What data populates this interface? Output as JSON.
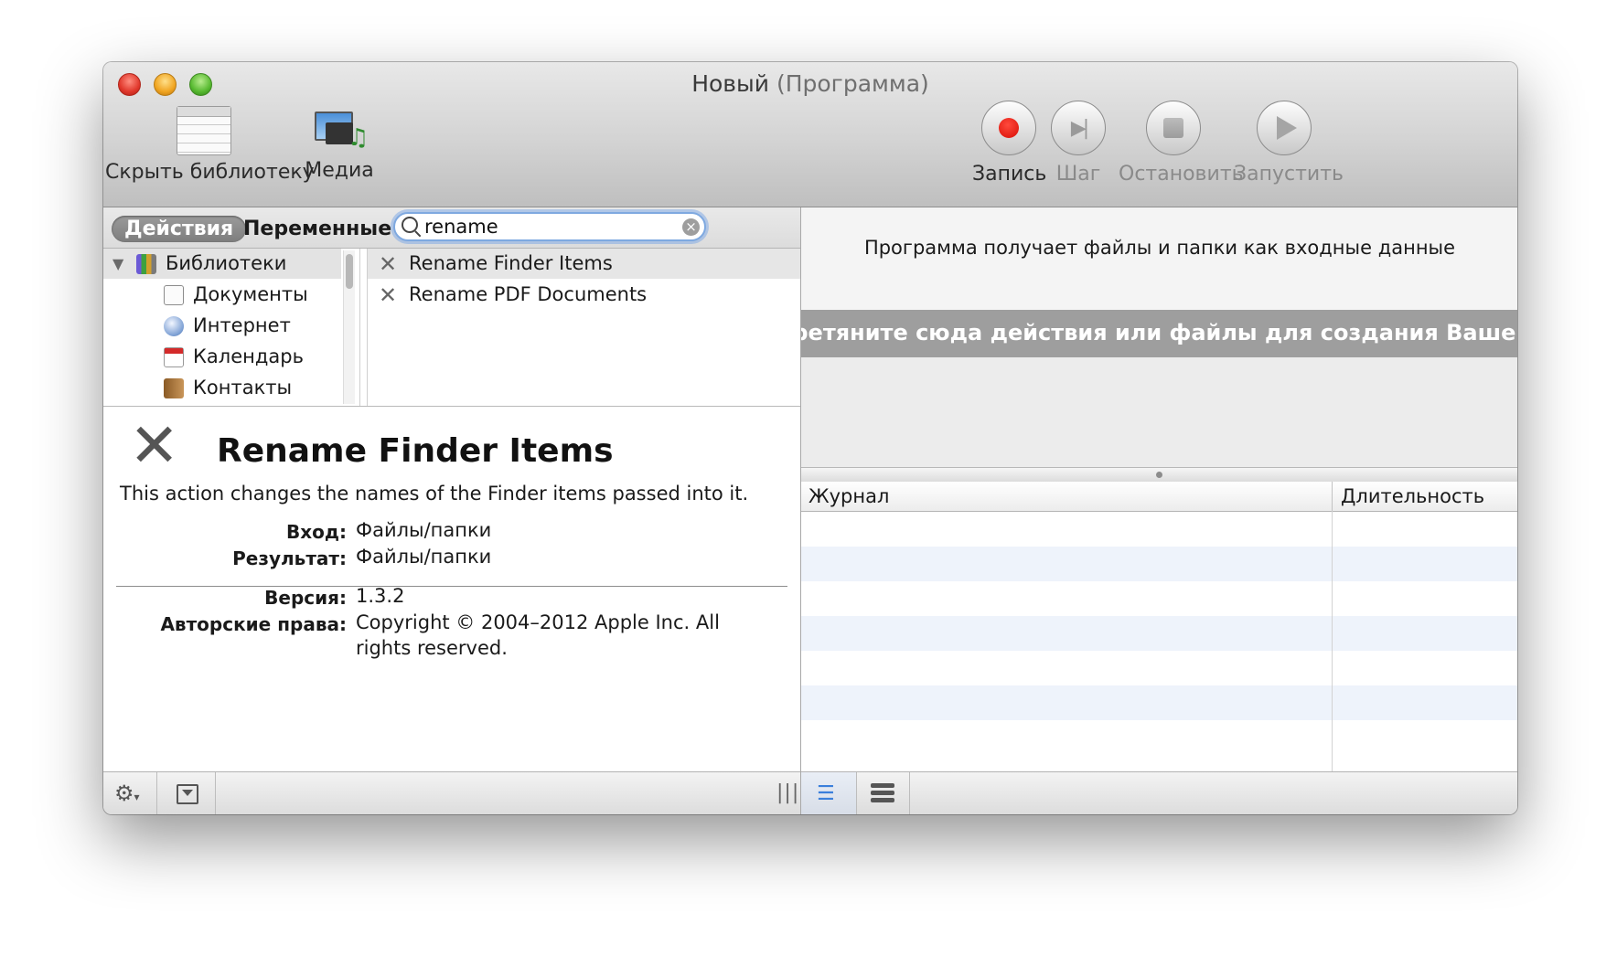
{
  "window": {
    "title": "Новый",
    "kind": "(Программа)"
  },
  "toolbar": {
    "hide_library": "Скрыть библиотеку",
    "media": "Медиа",
    "record": "Запись",
    "step": "Шаг",
    "stop": "Остановить",
    "run": "Запустить"
  },
  "tabs": {
    "actions": "Действия",
    "variables": "Переменные"
  },
  "search": {
    "value": "rename"
  },
  "library": {
    "root": "Библиотеки",
    "items": [
      "Документы",
      "Интернет",
      "Календарь",
      "Контакты"
    ]
  },
  "actions": [
    {
      "label": "Rename Finder Items",
      "selected": true
    },
    {
      "label": "Rename PDF Documents",
      "selected": false
    }
  ],
  "description": {
    "title": "Rename Finder Items",
    "summary": "This action changes the names of the Finder items passed into it.",
    "input_label": "Вход:",
    "input_value": "Файлы/папки",
    "result_label": "Результат:",
    "result_value": "Файлы/папки",
    "version_label": "Версия:",
    "version_value": "1.3.2",
    "copyright_label": "Авторские права:",
    "copyright_line1": "Copyright © 2004–2012 Apple Inc.  All",
    "copyright_line2": "rights reserved."
  },
  "workflow": {
    "input_info": "Программа получает файлы и папки как входные данные",
    "drop_hint": "Перетяните сюда действия или файлы для создания Вашего процесса."
  },
  "log": {
    "col_log": "Журнал",
    "col_duration": "Длительность"
  },
  "colors": {
    "record": "#d80d04",
    "search_focus": "#7fa9e0",
    "list_view_icon": "#3a7fdb"
  }
}
